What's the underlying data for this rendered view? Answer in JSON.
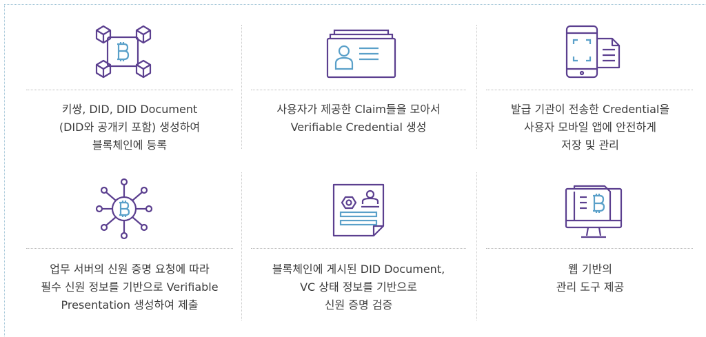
{
  "top_row": [
    {
      "icon": "blockchain-bitcoin-network-icon",
      "caption": "키쌍, DID, DID Document\n(DID와 공개키 포함) 생성하여\n블록체인에 등록"
    },
    {
      "icon": "id-card-icon",
      "caption": "사용자가 제공한 Claim들을 모아서\nVerifiable Credential 생성"
    },
    {
      "icon": "mobile-document-icon",
      "caption": "발급 기관이 전송한 Credential을\n사용자 모바일 앱에 안전하게\n저장 및 관리"
    }
  ],
  "bottom_row": [
    {
      "icon": "bitcoin-hub-icon",
      "caption": "업무 서버의 신원 증명 요청에 따라\n필수 신원 정보를 기반으로 Verifiable\nPresentation 생성하여 제출"
    },
    {
      "icon": "certificate-document-icon",
      "caption": "블록체인에 게시된 DID Document,\nVC 상태 정보를 기반으로\n신원 증명 검증"
    },
    {
      "icon": "monitor-bitcoin-icon",
      "caption": "웹 기반의\n관리 도구 제공"
    }
  ],
  "colors": {
    "purple": "#5b3f8f",
    "blue": "#5aa0c9",
    "text": "#3b3b3b"
  }
}
